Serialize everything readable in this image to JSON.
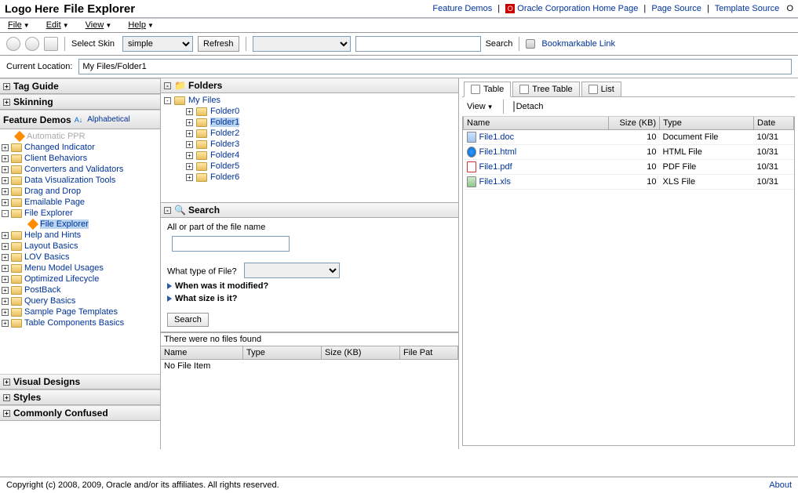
{
  "header": {
    "logo": "Logo Here",
    "app_title": "File Explorer",
    "links": {
      "feature_demos": "Feature Demos",
      "oracle_home": "Oracle Corporation Home Page",
      "page_source": "Page Source",
      "template_source": "Template Source",
      "o": "O"
    }
  },
  "menubar": {
    "file": "File",
    "edit": "Edit",
    "view": "View",
    "help": "Help"
  },
  "toolbar": {
    "skin_label": "Select Skin",
    "skin_value": "simple",
    "refresh": "Refresh",
    "search": "Search",
    "bookmark_link": "Bookmarkable Link"
  },
  "location": {
    "label": "Current Location:",
    "value": "My Files/Folder1"
  },
  "left_nav": {
    "tag_guide": "Tag Guide",
    "skinning": "Skinning",
    "feature_demos": "Feature Demos",
    "az": "A↓",
    "alphabetical": "Alphabetical",
    "top_cut": "Automatic PPR",
    "items": [
      "Changed Indicator",
      "Client Behaviors",
      "Converters and Validators",
      "Data Visualization Tools",
      "Drag and Drop",
      "Emailable Page",
      "File Explorer",
      "Help and Hints",
      "Layout Basics",
      "LOV Basics",
      "Menu Model Usages",
      "Optimized Lifecycle",
      "PostBack",
      "Query Basics",
      "Sample Page Templates",
      "Table Components Basics"
    ],
    "file_explorer_child": "File Explorer",
    "visual_designs": "Visual Designs",
    "styles": "Styles",
    "commonly_confused": "Commonly Confused"
  },
  "folders": {
    "title": "Folders",
    "root": "My Files",
    "items": [
      "Folder0",
      "Folder1",
      "Folder2",
      "Folder3",
      "Folder4",
      "Folder5",
      "Folder6"
    ],
    "selected": "Folder1"
  },
  "search": {
    "title": "Search",
    "name_label": "All or part of the file name",
    "type_label": "What type of File?",
    "when_label": "When was it modified?",
    "size_label": "What size is it?",
    "button": "Search"
  },
  "results": {
    "message": "There were no files found",
    "headers": {
      "name": "Name",
      "type": "Type",
      "size": "Size (KB)",
      "path": "File Pat"
    },
    "empty": "No File Item"
  },
  "right": {
    "tabs": {
      "table": "Table",
      "tree_table": "Tree Table",
      "list": "List"
    },
    "view": "View",
    "detach": "Detach",
    "headers": {
      "name": "Name",
      "size": "Size (KB)",
      "type": "Type",
      "date": "Date"
    },
    "rows": [
      {
        "name": "File1.doc",
        "size": "10",
        "type": "Document File",
        "date": "10/31",
        "ico": "doc"
      },
      {
        "name": "File1.html",
        "size": "10",
        "type": "HTML File",
        "date": "10/31",
        "ico": "html"
      },
      {
        "name": "File1.pdf",
        "size": "10",
        "type": "PDF File",
        "date": "10/31",
        "ico": "pdf"
      },
      {
        "name": "File1.xls",
        "size": "10",
        "type": "XLS File",
        "date": "10/31",
        "ico": "xls"
      }
    ]
  },
  "footer": {
    "copyright": "Copyright (c) 2008, 2009, Oracle and/or its affiliates. All rights reserved.",
    "about": "About"
  }
}
